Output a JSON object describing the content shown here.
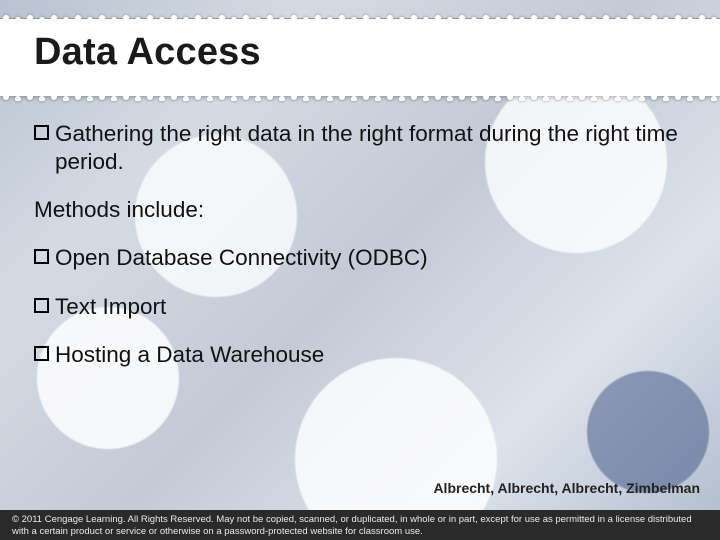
{
  "title": "Data Access",
  "body": {
    "items": [
      {
        "kind": "bullet",
        "text": "Gathering the right data in the right format during the right time period."
      },
      {
        "kind": "plain",
        "text": "Methods include:"
      },
      {
        "kind": "bullet",
        "text": "Open Database Connectivity (ODBC)"
      },
      {
        "kind": "bullet",
        "text": "Text Import"
      },
      {
        "kind": "bullet",
        "text": "Hosting a Data Warehouse"
      }
    ]
  },
  "attribution": "Albrecht, Albrecht, Albrecht, Zimbelman",
  "copyright": "© 2011 Cengage Learning. All Rights Reserved. May not be copied, scanned, or duplicated, in whole or in part, except for use as permitted in a license distributed with a certain product or service or otherwise on a password-protected website for classroom use."
}
